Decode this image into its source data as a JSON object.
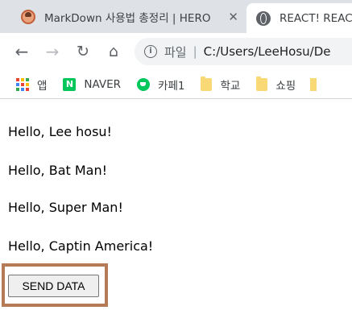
{
  "browser": {
    "tabs": [
      {
        "title": "MarkDown 사용법 총정리 | HERO",
        "icon": "avatar-icon",
        "close": "✕"
      },
      {
        "title": "REACT! REACT",
        "icon": "globe-icon"
      }
    ],
    "toolbar": {
      "back": "←",
      "forward": "→",
      "reload": "↻",
      "home": "⌂",
      "address_scheme": "파일",
      "address_sep": "|",
      "address_path": "C:/Users/LeeHosu/De"
    },
    "bookmarks": [
      {
        "label": "앱",
        "icon": "apps-icon"
      },
      {
        "label": "NAVER",
        "icon": "naver-icon",
        "glyph": "N"
      },
      {
        "label": "카페1",
        "icon": "cafe-icon"
      },
      {
        "label": "학교",
        "icon": "folder-icon"
      },
      {
        "label": "쇼핑",
        "icon": "folder-icon"
      }
    ]
  },
  "page": {
    "greetings": [
      "Hello, Lee hosu!",
      "Hello, Bat Man!",
      "Hello, Super Man!",
      "Hello, Captin America!"
    ],
    "send_button_label": "SEND DATA"
  },
  "colors": {
    "highlight_border": "#b47b56",
    "tabstrip_bg": "#dee1e6",
    "apps_dots": [
      "#ea4335",
      "#fbbc04",
      "#34a853",
      "#4285f4",
      "#ea4335",
      "#fbbc04",
      "#34a853",
      "#4285f4",
      "#ea4335"
    ]
  }
}
